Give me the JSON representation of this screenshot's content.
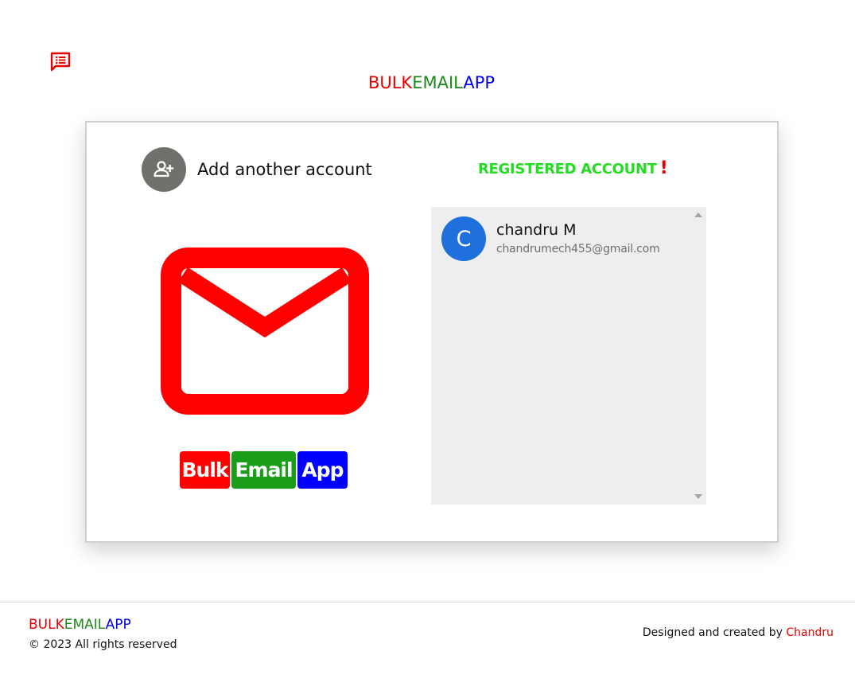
{
  "app": {
    "brand": {
      "part1": "BULK",
      "part2": "EMAIL",
      "part3": "APP",
      "colors": {
        "part1": "#e60000",
        "part2": "#1a8a1a",
        "part3": "#0000ee"
      }
    },
    "top_icon": "feedback-list-icon"
  },
  "left_panel": {
    "add_account_icon": "person-add-icon",
    "add_account_label": "Add another account",
    "logo_icon": "mail-envelope-icon",
    "badges": {
      "bulk": "Bulk",
      "email": "Email",
      "app": "App"
    }
  },
  "right_panel": {
    "title": "REGISTERED ACCOUNT",
    "title_mark": "!",
    "accounts": [
      {
        "initial": "C",
        "name": "chandru M",
        "email": "chandrumech455@gmail.com",
        "avatar_color": "#1f6fdc"
      }
    ]
  },
  "footer": {
    "brand": {
      "part1": "BULK",
      "part2": "EMAIL",
      "part3": "APP"
    },
    "copyright": "© 2023 All rights reserved",
    "credit_prefix": "Designed and created by",
    "credit_author": "Chandru"
  }
}
